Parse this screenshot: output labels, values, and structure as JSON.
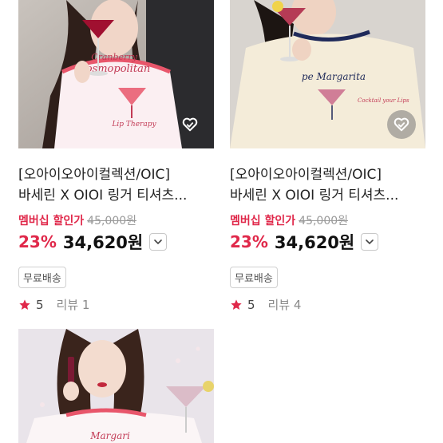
{
  "products": [
    {
      "title_line1": "[오아이오아이컬렉션/OIC]",
      "title_line2": "바세린 X OIOI 링거 티셔츠...",
      "member_label": "멤버십 할인가",
      "original_price": "45,000원",
      "discount": "23%",
      "price": "34,620원",
      "shipping_badge": "무료배송",
      "rating": "5",
      "review_label": "리뷰 1",
      "shirt_print": "Cosmopolitan",
      "liked_icon": "heart-outline-icon"
    },
    {
      "title_line1": "[오아이오아이컬렉션/OIC]",
      "title_line2": "바세린 X OIOI 링거 티셔츠...",
      "member_label": "멤버십 할인가",
      "original_price": "45,000원",
      "discount": "23%",
      "price": "34,620원",
      "shipping_badge": "무료배송",
      "rating": "5",
      "review_label": "리뷰 4",
      "shirt_print": "pe Margarita",
      "liked_icon": "heart-outline-icon"
    },
    {
      "shirt_print": "Margari"
    }
  ],
  "colors": {
    "accent_red": "#e0284a",
    "star": "#e0284a",
    "strike": "#9a9a9a"
  }
}
